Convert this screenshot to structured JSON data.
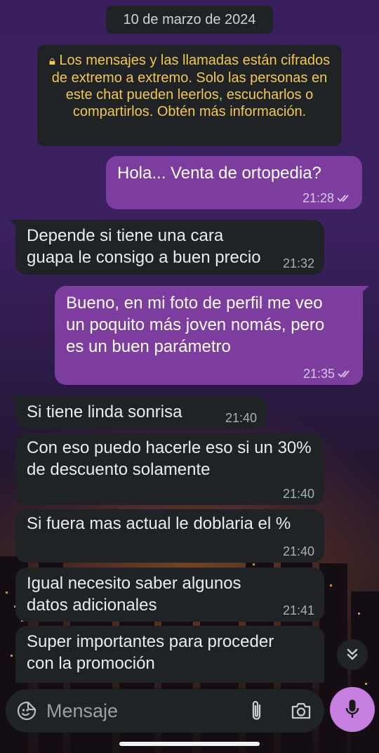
{
  "chat": {
    "date": "10 de marzo de 2024",
    "encryption_notice": "Los mensajes y las llamadas están cifrados de extremo a extremo. Solo las personas en este chat pueden leerlos, escucharlos o compartirlos. Obtén más información.",
    "messages": [
      {
        "direction": "out",
        "text": "Hola... Venta de ortopedia?",
        "time": "21:28",
        "status": "read"
      },
      {
        "direction": "in",
        "text": "Depende si tiene una cara guapa le consigo a buen precio",
        "time": "21:32"
      },
      {
        "direction": "out",
        "text": "Bueno, en mi foto de perfil me veo un poquito más joven nomás, pero es un buen parámetro",
        "time": "21:35",
        "status": "read"
      },
      {
        "direction": "in",
        "text": "Si tiene linda sonrisa",
        "time": "21:40"
      },
      {
        "direction": "in",
        "text": "Con eso puedo hacerle eso si un 30% de descuento solamente",
        "time": "21:40"
      },
      {
        "direction": "in",
        "text": "Si fuera mas actual le doblaria el %",
        "time": "21:40"
      },
      {
        "direction": "in",
        "text": "Igual necesito saber algunos datos adicionales",
        "time": "21:41"
      },
      {
        "direction": "in",
        "text": "Super importantes para proceder con la promoción",
        "time": ""
      }
    ]
  },
  "composer": {
    "placeholder": "Mensaje"
  },
  "icons": {
    "emoji": "sticker-icon",
    "attach": "paperclip-icon",
    "camera": "camera-icon",
    "mic": "microphone-icon",
    "scroll": "double-chevron-down-icon",
    "lock": "lock-icon"
  },
  "colors": {
    "outgoing_bubble": "#7d3d9f",
    "incoming_bubble": "#1f2326",
    "encryption_text": "#f2c94c",
    "mic_button": "#c67ee0"
  }
}
